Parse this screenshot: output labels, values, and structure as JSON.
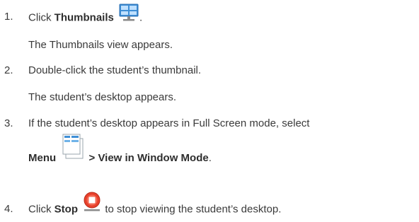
{
  "steps": [
    {
      "number": "1.",
      "prefix": "Click ",
      "bold": "Thumbnails",
      "icon": "monitor-thumbnails-icon",
      "suffix": ".",
      "result": "The Thumbnails view appears."
    },
    {
      "number": "2.",
      "text": "Double-click the student’s thumbnail.",
      "result": "The student’s desktop appears."
    },
    {
      "number": "3.",
      "text": "If the student’s desktop appears in Full Screen mode, select",
      "bold_menu": "Menu",
      "icon": "menu-pages-icon",
      "bold_rest": " > View in Window Mode",
      "suffix": "."
    },
    {
      "number": "4.",
      "prefix": "Click ",
      "bold": "Stop",
      "icon": "stop-record-icon",
      "suffix": " to stop viewing the student’s desktop."
    }
  ],
  "colors": {
    "text": "#3a3a3a",
    "stop_icon_red": "#e8412c",
    "monitor_icon_blue": "#3f8fd6"
  }
}
